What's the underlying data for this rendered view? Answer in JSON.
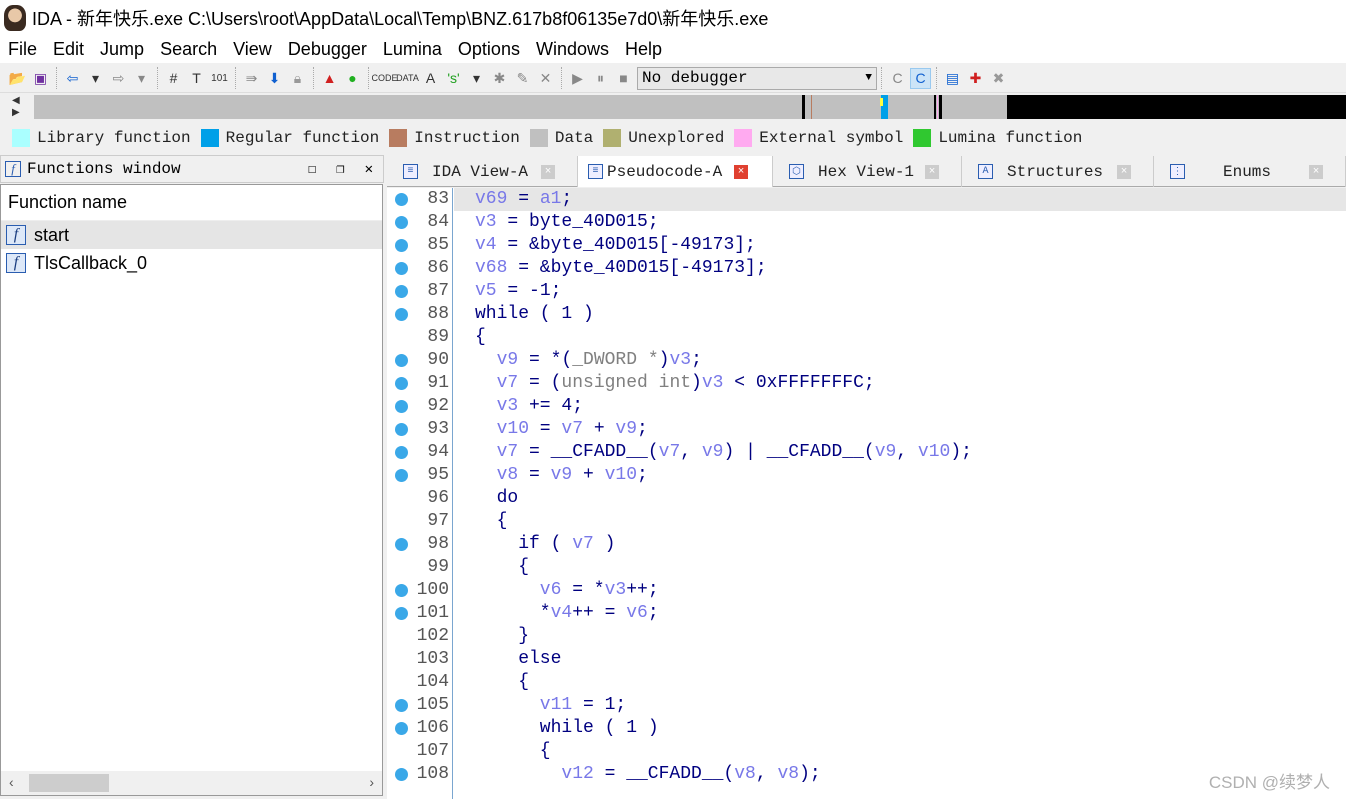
{
  "window": {
    "title": "IDA - 新年快乐.exe C:\\Users\\root\\AppData\\Local\\Temp\\BNZ.617b8f06135e7d0\\新年快乐.exe"
  },
  "menu": [
    "File",
    "Edit",
    "Jump",
    "Search",
    "View",
    "Debugger",
    "Lumina",
    "Options",
    "Windows",
    "Help"
  ],
  "toolbar": {
    "debugger_select": "No debugger"
  },
  "legend": [
    {
      "label": "Library function",
      "color": "#aaffff"
    },
    {
      "label": "Regular function",
      "color": "#00a0e8"
    },
    {
      "label": "Instruction",
      "color": "#b87c60"
    },
    {
      "label": "Data",
      "color": "#c0c0c0"
    },
    {
      "label": "Unexplored",
      "color": "#b0b070"
    },
    {
      "label": "External symbol",
      "color": "#ffaaf0"
    },
    {
      "label": "Lumina function",
      "color": "#30c830"
    }
  ],
  "functions_window": {
    "title": "Functions window",
    "column": "Function name",
    "items": [
      "start",
      "TlsCallback_0"
    ],
    "selected": 0
  },
  "tabs": [
    {
      "label": "IDA View-A",
      "active": false
    },
    {
      "label": "Pseudocode-A",
      "active": true
    },
    {
      "label": "Hex View-1",
      "active": false
    },
    {
      "label": "Structures",
      "active": false
    },
    {
      "label": "Enums",
      "active": false
    }
  ],
  "code": {
    "current_line": 83,
    "lines": [
      {
        "num": "83",
        "bp": true,
        "indent": 0,
        "tokens": [
          [
            "v",
            "v69"
          ],
          [
            "n",
            " = "
          ],
          [
            "v",
            "a1"
          ],
          [
            "n",
            ";"
          ]
        ]
      },
      {
        "num": "84",
        "bp": true,
        "indent": 0,
        "tokens": [
          [
            "v",
            "v3"
          ],
          [
            "n",
            " = byte_40D015;"
          ]
        ]
      },
      {
        "num": "85",
        "bp": true,
        "indent": 0,
        "tokens": [
          [
            "v",
            "v4"
          ],
          [
            "n",
            " = &byte_40D015[-49173];"
          ]
        ]
      },
      {
        "num": "86",
        "bp": true,
        "indent": 0,
        "tokens": [
          [
            "v",
            "v68"
          ],
          [
            "n",
            " = &byte_40D015[-49173];"
          ]
        ]
      },
      {
        "num": "87",
        "bp": true,
        "indent": 0,
        "tokens": [
          [
            "v",
            "v5"
          ],
          [
            "n",
            " = -1;"
          ]
        ]
      },
      {
        "num": "88",
        "bp": true,
        "indent": 0,
        "tokens": [
          [
            "k",
            "while ( 1 )"
          ]
        ]
      },
      {
        "num": "89",
        "bp": false,
        "indent": 0,
        "tokens": [
          [
            "n",
            "{"
          ]
        ]
      },
      {
        "num": "90",
        "bp": true,
        "indent": 1,
        "tokens": [
          [
            "v",
            "v9"
          ],
          [
            "n",
            " = *("
          ],
          [
            "g",
            "_DWORD *"
          ],
          [
            "n",
            ")"
          ],
          [
            "v",
            "v3"
          ],
          [
            "n",
            ";"
          ]
        ]
      },
      {
        "num": "91",
        "bp": true,
        "indent": 1,
        "tokens": [
          [
            "v",
            "v7"
          ],
          [
            "n",
            " = ("
          ],
          [
            "g",
            "unsigned int"
          ],
          [
            "n",
            ")"
          ],
          [
            "v",
            "v3"
          ],
          [
            "n",
            " < 0xFFFFFFFC;"
          ]
        ]
      },
      {
        "num": "92",
        "bp": true,
        "indent": 1,
        "tokens": [
          [
            "v",
            "v3"
          ],
          [
            "n",
            " += 4;"
          ]
        ]
      },
      {
        "num": "93",
        "bp": true,
        "indent": 1,
        "tokens": [
          [
            "v",
            "v10"
          ],
          [
            "n",
            " = "
          ],
          [
            "v",
            "v7"
          ],
          [
            "n",
            " + "
          ],
          [
            "v",
            "v9"
          ],
          [
            "n",
            ";"
          ]
        ]
      },
      {
        "num": "94",
        "bp": true,
        "indent": 1,
        "tokens": [
          [
            "v",
            "v7"
          ],
          [
            "n",
            " = __CFADD__("
          ],
          [
            "v",
            "v7"
          ],
          [
            "n",
            ", "
          ],
          [
            "v",
            "v9"
          ],
          [
            "n",
            ") | __CFADD__("
          ],
          [
            "v",
            "v9"
          ],
          [
            "n",
            ", "
          ],
          [
            "v",
            "v10"
          ],
          [
            "n",
            ");"
          ]
        ]
      },
      {
        "num": "95",
        "bp": true,
        "indent": 1,
        "tokens": [
          [
            "v",
            "v8"
          ],
          [
            "n",
            " = "
          ],
          [
            "v",
            "v9"
          ],
          [
            "n",
            " + "
          ],
          [
            "v",
            "v10"
          ],
          [
            "n",
            ";"
          ]
        ]
      },
      {
        "num": "96",
        "bp": false,
        "indent": 1,
        "tokens": [
          [
            "k",
            "do"
          ]
        ]
      },
      {
        "num": "97",
        "bp": false,
        "indent": 1,
        "tokens": [
          [
            "n",
            "{"
          ]
        ]
      },
      {
        "num": "98",
        "bp": true,
        "indent": 2,
        "tokens": [
          [
            "k",
            "if ( "
          ],
          [
            "v",
            "v7"
          ],
          [
            "k",
            " )"
          ]
        ]
      },
      {
        "num": "99",
        "bp": false,
        "indent": 2,
        "tokens": [
          [
            "n",
            "{"
          ]
        ]
      },
      {
        "num": "100",
        "bp": true,
        "indent": 3,
        "tokens": [
          [
            "v",
            "v6"
          ],
          [
            "n",
            " = *"
          ],
          [
            "v",
            "v3"
          ],
          [
            "n",
            "++;"
          ]
        ]
      },
      {
        "num": "101",
        "bp": true,
        "indent": 3,
        "tokens": [
          [
            "n",
            "*"
          ],
          [
            "v",
            "v4"
          ],
          [
            "n",
            "++ = "
          ],
          [
            "v",
            "v6"
          ],
          [
            "n",
            ";"
          ]
        ]
      },
      {
        "num": "102",
        "bp": false,
        "indent": 2,
        "tokens": [
          [
            "n",
            "}"
          ]
        ]
      },
      {
        "num": "103",
        "bp": false,
        "indent": 2,
        "tokens": [
          [
            "k",
            "else"
          ]
        ]
      },
      {
        "num": "104",
        "bp": false,
        "indent": 2,
        "tokens": [
          [
            "n",
            "{"
          ]
        ]
      },
      {
        "num": "105",
        "bp": true,
        "indent": 3,
        "tokens": [
          [
            "v",
            "v11"
          ],
          [
            "n",
            " = 1;"
          ]
        ]
      },
      {
        "num": "106",
        "bp": true,
        "indent": 3,
        "tokens": [
          [
            "k",
            "while ( 1 )"
          ]
        ]
      },
      {
        "num": "107",
        "bp": false,
        "indent": 3,
        "tokens": [
          [
            "n",
            "{"
          ]
        ]
      },
      {
        "num": "108",
        "bp": true,
        "indent": 4,
        "tokens": [
          [
            "v",
            "v12"
          ],
          [
            "n",
            " = __CFADD__("
          ],
          [
            "v",
            "v8"
          ],
          [
            "n",
            ", "
          ],
          [
            "v",
            "v8"
          ],
          [
            "n",
            ");"
          ]
        ]
      }
    ]
  },
  "watermark": "CSDN @续梦人"
}
